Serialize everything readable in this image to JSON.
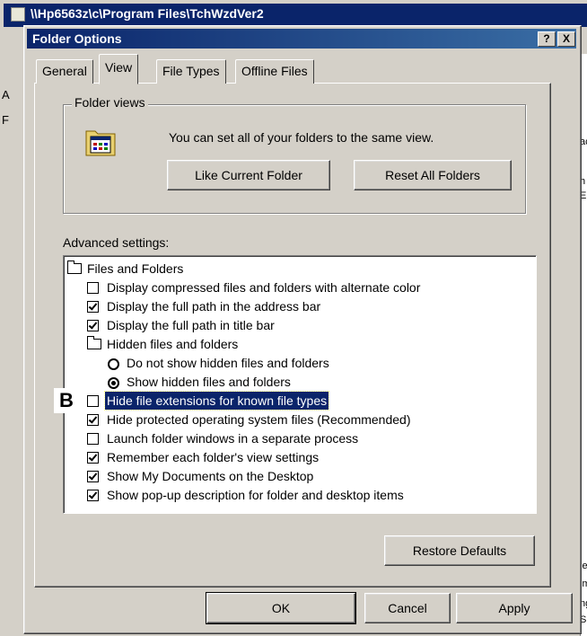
{
  "bg_window": {
    "title": "\\\\Hp6563z\\c\\Program Files\\TchWzdVer2",
    "left_letters": [
      "A",
      "F"
    ],
    "right_fragments": [
      "ac",
      "h",
      "E",
      "le.",
      "im",
      "ng",
      "SI"
    ]
  },
  "dialog": {
    "title": "Folder Options",
    "help_button": "?",
    "close_button": "X"
  },
  "tabs": [
    {
      "label": "General",
      "active": false
    },
    {
      "label": "View",
      "active": true
    },
    {
      "label": "File Types",
      "active": false
    },
    {
      "label": "Offline Files",
      "active": false
    }
  ],
  "folder_views": {
    "legend": "Folder views",
    "description": "You can set all of your folders to the same view.",
    "like_current_button": "Like Current Folder",
    "reset_all_button": "Reset All Folders"
  },
  "advanced": {
    "label": "Advanced settings:",
    "marker": "B",
    "items": [
      {
        "kind": "folder",
        "text": "Files and Folders",
        "level": 0
      },
      {
        "kind": "check",
        "text": "Display compressed files and folders with alternate color",
        "checked": false,
        "level": 1
      },
      {
        "kind": "check",
        "text": "Display the full path in the address bar",
        "checked": true,
        "level": 1
      },
      {
        "kind": "check",
        "text": "Display the full path in title bar",
        "checked": true,
        "level": 1
      },
      {
        "kind": "folder",
        "text": "Hidden files and folders",
        "level": 1
      },
      {
        "kind": "radio",
        "text": "Do not show hidden files and folders",
        "checked": false,
        "level": 2
      },
      {
        "kind": "radio",
        "text": "Show hidden files and folders",
        "checked": true,
        "level": 2
      },
      {
        "kind": "check",
        "text": "Hide file extensions for known file types",
        "checked": false,
        "level": 1,
        "selected": true
      },
      {
        "kind": "check",
        "text": "Hide protected operating system files (Recommended)",
        "checked": true,
        "level": 1
      },
      {
        "kind": "check",
        "text": "Launch folder windows in a separate process",
        "checked": false,
        "level": 1
      },
      {
        "kind": "check",
        "text": "Remember each folder's view settings",
        "checked": true,
        "level": 1
      },
      {
        "kind": "check",
        "text": "Show My Documents on the Desktop",
        "checked": true,
        "level": 1
      },
      {
        "kind": "check",
        "text": "Show pop-up description for folder and desktop items",
        "checked": true,
        "level": 1
      }
    ]
  },
  "buttons": {
    "restore_defaults": "Restore Defaults",
    "ok": "OK",
    "cancel": "Cancel",
    "apply": "Apply"
  }
}
